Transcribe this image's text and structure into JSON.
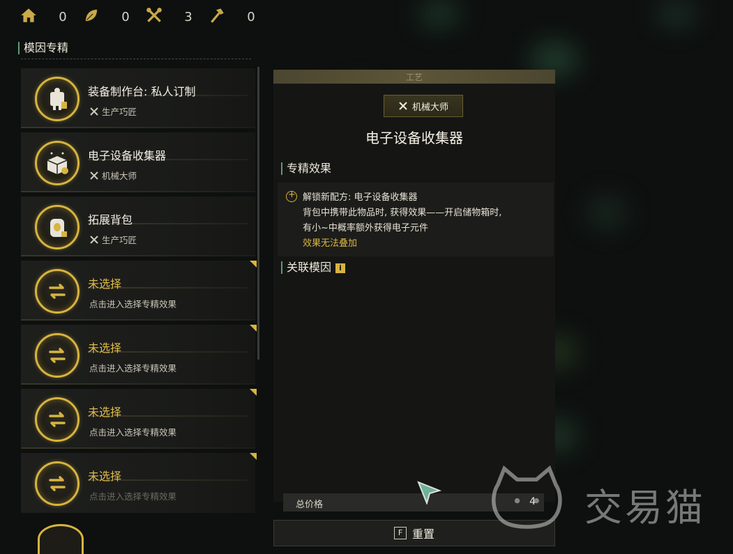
{
  "resources": [
    {
      "icon": "home-icon",
      "value": "0"
    },
    {
      "icon": "leaf-icon",
      "value": "0"
    },
    {
      "icon": "tools-icon",
      "value": "3"
    },
    {
      "icon": "hammer-icon",
      "value": "0"
    }
  ],
  "section_title": "模因专精",
  "list": [
    {
      "title": "装备制作台: 私人订制",
      "sub": "生产巧匠",
      "selected": true,
      "icon": "workbench-icon"
    },
    {
      "title": "电子设备收集器",
      "sub": "机械大师",
      "selected": true,
      "icon": "electronic-collector-icon"
    },
    {
      "title": "拓展背包",
      "sub": "生产巧匠",
      "selected": true,
      "icon": "backpack-icon"
    },
    {
      "title": "未选择",
      "sub": "点击进入选择专精效果",
      "selected": false,
      "icon": "swap-icon"
    },
    {
      "title": "未选择",
      "sub": "点击进入选择专精效果",
      "selected": false,
      "icon": "swap-icon"
    },
    {
      "title": "未选择",
      "sub": "点击进入选择专精效果",
      "selected": false,
      "icon": "swap-icon"
    },
    {
      "title": "未选择",
      "sub": "点击进入选择专精效果",
      "selected": false,
      "icon": "swap-icon"
    }
  ],
  "panel": {
    "craft_label": "工艺",
    "skill_tab": "机械大师",
    "title": "电子设备收集器",
    "effects_head": "专精效果",
    "effect_lines": [
      "解锁新配方: 电子设备收集器",
      "背包中携带此物品时, 获得效果——开启储物箱时,",
      "有小~中概率额外获得电子元件"
    ],
    "effect_note": "效果无法叠加",
    "related_head": "关联模因",
    "price_label": "总价格",
    "price_value": "4",
    "reset_key": "F",
    "reset_label": "重置"
  },
  "watermark": "交易猫",
  "colors": {
    "gold": "#d7b440",
    "accent": "#5a9a7a",
    "panel": "#151614"
  }
}
